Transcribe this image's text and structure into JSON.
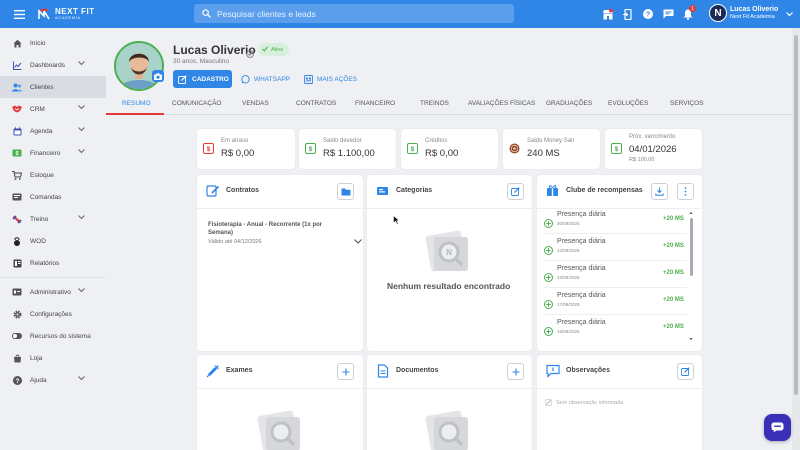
{
  "colors": {
    "primary": "#2f86e6",
    "success": "#4caf50",
    "danger": "#e53935",
    "chat": "#3a2fb8"
  },
  "topbar": {
    "logo_line1": "NEXT FIT",
    "logo_line2": "ACADEMIA",
    "search_placeholder": "Pesquisar clientes e leads",
    "icons": [
      "menu-icon",
      "store-icon",
      "door-icon",
      "help-icon",
      "chat-icon",
      "bell-icon"
    ],
    "notification_count": "1",
    "user_initial": "N",
    "user_name": "Lucas Oliverio",
    "user_org": "Next Fit Academia"
  },
  "sidebar": {
    "items": [
      {
        "label": "Início",
        "icon": "home-icon"
      },
      {
        "label": "Dashboards",
        "icon": "chart-icon"
      },
      {
        "label": "Clientes",
        "icon": "users-icon"
      },
      {
        "label": "CRM",
        "icon": "handshake-icon"
      },
      {
        "label": "Agenda",
        "icon": "calendar-icon"
      },
      {
        "label": "Financeiro",
        "icon": "money-icon"
      },
      {
        "label": "Estoque",
        "icon": "cart-icon"
      },
      {
        "label": "Comandas",
        "icon": "receipt-icon"
      },
      {
        "label": "Treino",
        "icon": "dumbbell-icon"
      },
      {
        "label": "WOD",
        "icon": "kettlebell-icon"
      },
      {
        "label": "Relatórios",
        "icon": "report-icon"
      },
      {
        "label": "Administrativo",
        "icon": "admin-icon"
      },
      {
        "label": "Configurações",
        "icon": "gear-icon"
      },
      {
        "label": "Recursos do sistema",
        "icon": "toggle-icon"
      },
      {
        "label": "Loja",
        "icon": "shop-icon"
      },
      {
        "label": "Ajuda",
        "icon": "help-icon"
      }
    ]
  },
  "profile": {
    "name": "Lucas Oliverio",
    "status": "Ativo",
    "subtitle": "30 anos, Masculino",
    "btn_cadastro": "CADASTRO",
    "btn_whatsapp": "WHATSAPP",
    "btn_more": "MAIS AÇÕES"
  },
  "tabs": [
    "RESUMO",
    "COMUNICAÇÃO",
    "VENDAS",
    "CONTRATOS",
    "FINANCEIRO",
    "TREINOS",
    "AVALIAÇÕES FÍSICAS",
    "GRADUAÇÕES",
    "EVOLUÇÕES",
    "SERVIÇOS"
  ],
  "stats": [
    {
      "label": "Em atraso",
      "value": "R$ 0,00",
      "icon": "money-alert-icon"
    },
    {
      "label": "Saldo devedor",
      "value": "R$ 1.100,00",
      "icon": "money-icon"
    },
    {
      "label": "Créditos",
      "value": "R$ 0,00",
      "icon": "money-icon"
    },
    {
      "label": "Saldo Money San",
      "value": "240 MS",
      "icon": "coin-icon"
    },
    {
      "label": "Próx. vencimento",
      "value": "04/01/2026",
      "sub": "R$ 100,00",
      "icon": "calendar-money-icon"
    }
  ],
  "contratos": {
    "title": "Contratos",
    "item_name": "Fisioterapia - Anual - Recorrente (1x por Semana)",
    "item_valid": "Válido até 04/12/2026"
  },
  "categorias": {
    "title": "Categorias",
    "empty": "Nenhum resultado encontrado"
  },
  "clube": {
    "title": "Clube de recompensas",
    "items": [
      {
        "name": "Presença diária",
        "date": "30/09/2025",
        "points": "+20 MS"
      },
      {
        "name": "Presença diária",
        "date": "24/09/2025",
        "points": "+20 MS"
      },
      {
        "name": "Presença diária",
        "date": "23/09/2025",
        "points": "+20 MS"
      },
      {
        "name": "Presença diária",
        "date": "17/09/2025",
        "points": "+20 MS"
      },
      {
        "name": "Presença diária",
        "date": "16/09/2025",
        "points": "+20 MS"
      }
    ]
  },
  "exames": {
    "title": "Exames"
  },
  "documentos": {
    "title": "Documentos"
  },
  "observacoes": {
    "title": "Observações",
    "empty": "Sem observação informada"
  }
}
